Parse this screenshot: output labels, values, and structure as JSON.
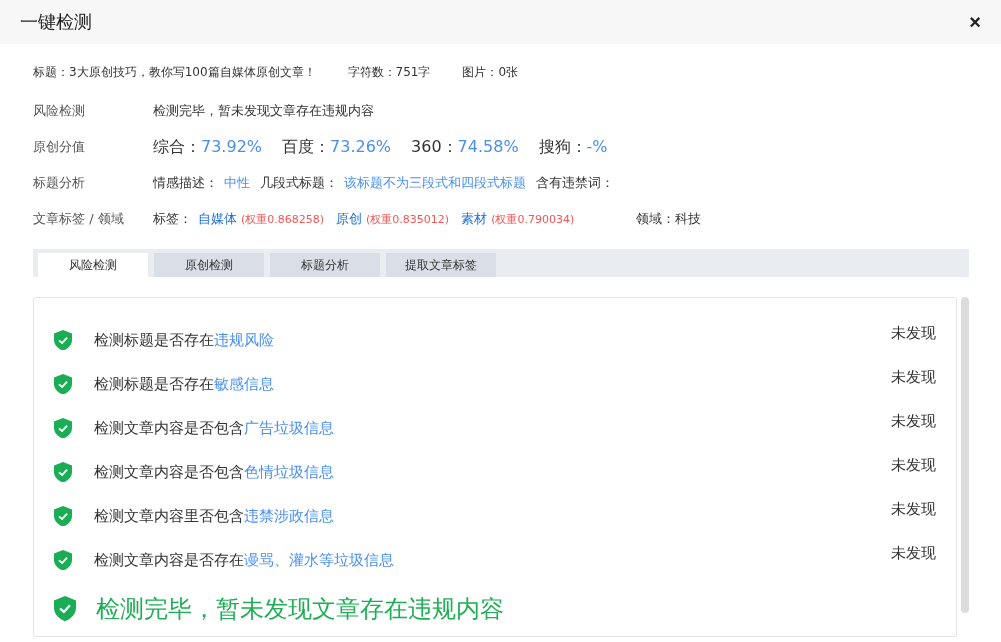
{
  "window": {
    "title": "一键检测",
    "close": "×"
  },
  "meta": [
    {
      "text": "标题：3大原创技巧，教你写100篇自媒体原创文章！"
    },
    {
      "text": "字符数：751字"
    },
    {
      "text": "图片：0张"
    }
  ],
  "risk": {
    "label": "风险检测",
    "text": "检测完毕，暂未发现文章存在违规内容"
  },
  "originality": {
    "label": "原创分值",
    "scores": [
      {
        "label": "综合：",
        "value": "73.92%"
      },
      {
        "label": "百度：",
        "value": "73.26%"
      },
      {
        "label": "360：",
        "value": "74.58%"
      },
      {
        "label": "搜狗：",
        "value": "-%"
      }
    ]
  },
  "title_analysis": {
    "label": "标题分析",
    "items": [
      {
        "label": "情感描述：",
        "value": "中性"
      },
      {
        "label": "几段式标题：",
        "value": "该标题不为三段式和四段式标题"
      },
      {
        "label": "含有违禁词："
      }
    ]
  },
  "tags_row": {
    "label": "文章标签 / 领域",
    "prefix": "标签：",
    "tags": [
      {
        "name": "自媒体",
        "weight": "(权重0.868258)"
      },
      {
        "name": "原创",
        "weight": "(权重0.835012)"
      },
      {
        "name": "素材",
        "weight": "(权重0.790034)"
      }
    ],
    "domain": "领域：科技"
  },
  "tabs": [
    {
      "label": "风险检测",
      "selected": true
    },
    {
      "label": "原创检测",
      "selected": false
    },
    {
      "label": "标题分析",
      "selected": false
    },
    {
      "label": "提取文章标签",
      "selected": false
    }
  ],
  "checks": [
    {
      "text": "检测标题是否存在",
      "highlight": "违规风险",
      "result": "未发现",
      "passed": true
    },
    {
      "text": "检测标题是否存在",
      "highlight": "敏感信息",
      "result": "未发现",
      "passed": true
    },
    {
      "text": "检测文章内容是否包含",
      "highlight": "广告垃圾信息",
      "result": "未发现",
      "passed": true
    },
    {
      "text": "检测文章内容是否包含",
      "highlight": "色情垃圾信息",
      "result": "未发现",
      "passed": true
    },
    {
      "text": "检测文章内容里否包含",
      "highlight": "违禁涉政信息",
      "result": "未发现",
      "passed": true
    },
    {
      "text": "检测文章内容是否存在",
      "highlight": "谩骂、灌水等垃圾信息",
      "result": "未发现",
      "passed": true
    }
  ],
  "summary": {
    "text": "检测完毕，暂未发现文章存在违规内容",
    "passed": true
  }
}
